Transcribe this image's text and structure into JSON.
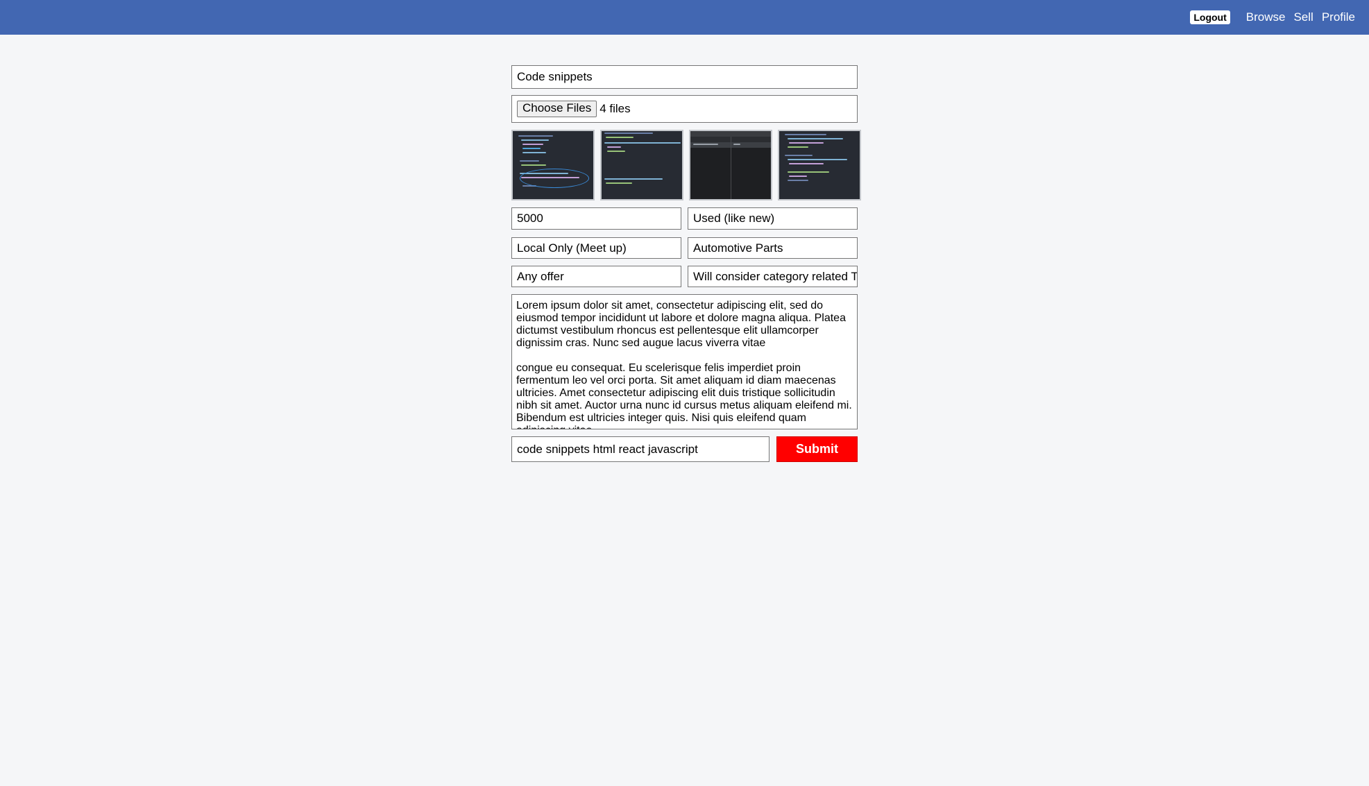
{
  "navbar": {
    "logout_label": "Logout",
    "links": [
      "Browse",
      "Sell",
      "Profile"
    ],
    "background": "#4267b2"
  },
  "form": {
    "title_value": "Code snippets",
    "file_button_label": "Choose Files",
    "file_status": "4 files",
    "price_value": "5000",
    "condition_value": "Used (like new)",
    "shipping_value": "Local Only (Meet up)",
    "category_value": "Automotive Parts",
    "offer_value": "Any offer",
    "trade_value": "Will consider category related Trades",
    "description_value": "Lorem ipsum dolor sit amet, consectetur adipiscing elit, sed do eiusmod tempor incididunt ut labore et dolore magna aliqua. Platea dictumst vestibulum rhoncus est pellentesque elit ullamcorper dignissim cras. Nunc sed augue lacus viverra vitae\n\ncongue eu consequat. Eu scelerisque felis imperdiet proin fermentum leo vel orci porta. Sit amet aliquam id diam maecenas ultricies. Amet consectetur adipiscing elit duis tristique sollicitudin nibh sit amet. Auctor urna nunc id cursus metus aliquam eleifend mi. Bibendum est ultricies integer quis. Nisi quis eleifend quam adipiscing vitae.",
    "tags_value": "code snippets html react javascript",
    "submit_label": "Submit",
    "submit_color": "#ff0000"
  },
  "thumbnails": [
    "code-screenshot-1",
    "code-screenshot-2",
    "debugger-screenshot",
    "code-screenshot-4"
  ]
}
